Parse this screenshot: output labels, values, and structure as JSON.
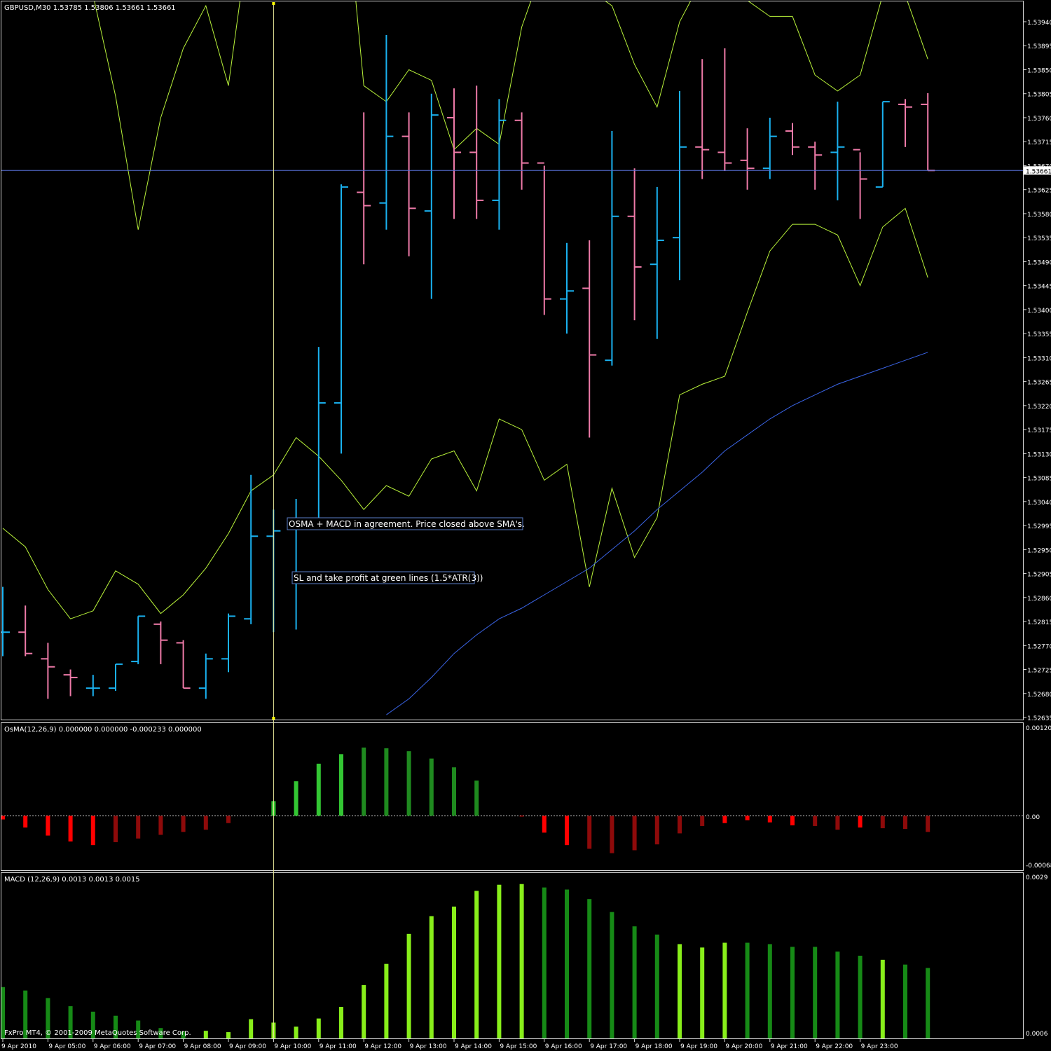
{
  "main_panel": {
    "title": "GBPUSD,M30  1.53785 1.53806 1.53661 1.53661",
    "current_price_label": "1.53661",
    "price_ticks": [
      "1.53940",
      "1.53895",
      "1.53850",
      "1.53805",
      "1.53760",
      "1.53715",
      "1.53670",
      "1.53625",
      "1.53580",
      "1.53535",
      "1.53490",
      "1.53445",
      "1.53400",
      "1.53355",
      "1.53310",
      "1.53265",
      "1.53220",
      "1.53175",
      "1.53130",
      "1.53085",
      "1.53040",
      "1.52995",
      "1.52950",
      "1.52905",
      "1.52860",
      "1.52815",
      "1.52770",
      "1.52725",
      "1.52680",
      "1.52635"
    ]
  },
  "osma_panel": {
    "title": "OsMA(12,26,9) 0.000000 0.000000 -0.000233 0.000000",
    "top_label": "0.001206",
    "zero_label": "0.00",
    "bottom_label": "-0.000685"
  },
  "macd_panel": {
    "title": "MACD (12,26,9) 0.0013 0.0013 0.0015",
    "top_label": "0.0029",
    "bottom_label": "0.0006"
  },
  "annotations": [
    "OSMA + MACD in agreement. Price closed above SMA's.",
    "SL and take profit at green lines (1.5*ATR(3))"
  ],
  "copyright": "FxPro MT4, © 2001-2009 MetaQuotes Software Corp.",
  "time_labels": [
    "9 Apr 2010",
    "9 Apr 05:00",
    "9 Apr 06:00",
    "9 Apr 07:00",
    "9 Apr 08:00",
    "9 Apr 09:00",
    "9 Apr 10:00",
    "9 Apr 11:00",
    "9 Apr 12:00",
    "9 Apr 13:00",
    "9 Apr 14:00",
    "9 Apr 15:00",
    "9 Apr 16:00",
    "9 Apr 17:00",
    "9 Apr 18:00",
    "9 Apr 19:00",
    "9 Apr 20:00",
    "9 Apr 21:00",
    "9 Apr 22:00",
    "9 Apr 23:00"
  ],
  "colors": {
    "background": "#000000",
    "bull_bar": "#1ab2f0",
    "bear_bar": "#ee7aa8",
    "band_line": "#b8f23a",
    "sma_line": "#3a64e6",
    "price_line": "#5870d8",
    "osma_up_strong": "#33c633",
    "osma_up_weak": "#1f8a1f",
    "osma_down_strong": "#ff0000",
    "osma_down_weak": "#8e0a0a",
    "macd_rising": "#88ee1a",
    "macd_falling": "#168a16",
    "frame": "#d8d8d8",
    "text": "#ffffff"
  },
  "chart_data": [
    {
      "type": "ohlc",
      "name": "GBPUSD,M30",
      "time_step_minutes": 30,
      "first_bar_time": "9 Apr 2010 04:00",
      "ylim": [
        1.52635,
        1.53985
      ],
      "ohlc": [
        [
          1.52795,
          1.5288,
          1.5275,
          1.52795
        ],
        [
          1.52795,
          1.52845,
          1.5275,
          1.52755
        ],
        [
          1.52745,
          1.52775,
          1.5267,
          1.5273
        ],
        [
          1.52715,
          1.52725,
          1.52675,
          1.5271
        ],
        [
          1.5269,
          1.52715,
          1.52675,
          1.5269
        ],
        [
          1.5269,
          1.52735,
          1.52685,
          1.52735
        ],
        [
          1.5274,
          1.52825,
          1.52735,
          1.52825
        ],
        [
          1.5281,
          1.52815,
          1.52735,
          1.5278
        ],
        [
          1.52775,
          1.5278,
          1.5269,
          1.5269
        ],
        [
          1.5269,
          1.52755,
          1.5267,
          1.52745
        ],
        [
          1.52745,
          1.5283,
          1.5272,
          1.52825
        ],
        [
          1.5282,
          1.5309,
          1.5281,
          1.52975
        ],
        [
          1.52975,
          1.53025,
          1.52795,
          1.52985
        ],
        [
          1.5299,
          1.53045,
          1.528,
          1.52995
        ],
        [
          1.52995,
          1.5333,
          1.5299,
          1.53225
        ],
        [
          1.53225,
          1.53635,
          1.5313,
          1.5363
        ],
        [
          1.5362,
          1.5377,
          1.53485,
          1.53595
        ],
        [
          1.536,
          1.53915,
          1.5355,
          1.53725
        ],
        [
          1.53725,
          1.5377,
          1.535,
          1.5359
        ],
        [
          1.53585,
          1.53805,
          1.5342,
          1.53765
        ],
        [
          1.5376,
          1.53815,
          1.5357,
          1.53695
        ],
        [
          1.53695,
          1.5382,
          1.5357,
          1.53605
        ],
        [
          1.53605,
          1.53795,
          1.5355,
          1.53755
        ],
        [
          1.53755,
          1.5377,
          1.53625,
          1.53675
        ],
        [
          1.53675,
          1.5367,
          1.5339,
          1.5342
        ],
        [
          1.5342,
          1.53525,
          1.53355,
          1.53435
        ],
        [
          1.5344,
          1.5353,
          1.5316,
          1.53315
        ],
        [
          1.53305,
          1.53735,
          1.53295,
          1.53575
        ],
        [
          1.53575,
          1.53665,
          1.5338,
          1.5348
        ],
        [
          1.53485,
          1.5363,
          1.53345,
          1.5353
        ],
        [
          1.53535,
          1.5381,
          1.53455,
          1.53705
        ],
        [
          1.53705,
          1.5387,
          1.53645,
          1.537
        ],
        [
          1.53695,
          1.5389,
          1.5366,
          1.53675
        ],
        [
          1.5368,
          1.5374,
          1.53625,
          1.53665
        ],
        [
          1.53665,
          1.5376,
          1.53645,
          1.53725
        ],
        [
          1.53735,
          1.5375,
          1.5369,
          1.53705
        ],
        [
          1.53705,
          1.53715,
          1.53625,
          1.5369
        ],
        [
          1.53695,
          1.5379,
          1.53605,
          1.53705
        ],
        [
          1.537,
          1.53695,
          1.5357,
          1.53645
        ],
        [
          1.5363,
          1.5379,
          1.5363,
          1.5379
        ],
        [
          1.53785,
          1.53795,
          1.53705,
          1.5378
        ],
        [
          1.53785,
          1.53806,
          1.53661,
          1.53661
        ]
      ],
      "upper_band": [
        1.5398,
        1.5403,
        1.5416,
        1.5423,
        1.5399,
        1.538,
        1.5355,
        1.5376,
        1.5389,
        1.5397,
        1.5382,
        1.5413,
        1.5424,
        1.543,
        1.5429,
        1.5427,
        1.5382,
        1.5379,
        1.5385,
        1.5383,
        1.537,
        1.5374,
        1.5371,
        1.5393,
        1.5405,
        1.541,
        1.54,
        1.5397,
        1.5386,
        1.5378,
        1.5394,
        1.5402,
        1.5406,
        1.5398,
        1.5395,
        1.5395,
        1.5384,
        1.5381,
        1.5384,
        1.5399,
        1.5399,
        1.5387
      ],
      "lower_band": [
        1.5299,
        1.52955,
        1.52875,
        1.5282,
        1.52835,
        1.5291,
        1.52885,
        1.5283,
        1.52865,
        1.52915,
        1.5298,
        1.5306,
        1.5309,
        1.5316,
        1.53125,
        1.5308,
        1.53025,
        1.5307,
        1.5305,
        1.5312,
        1.53135,
        1.5306,
        1.53195,
        1.53175,
        1.5308,
        1.5311,
        1.5288,
        1.53065,
        1.52935,
        1.5301,
        1.5324,
        1.5326,
        1.53275,
        1.53395,
        1.5351,
        1.5356,
        1.5356,
        1.5354,
        1.53445,
        1.53555,
        1.5359,
        1.5346
      ],
      "sma": [
        null,
        null,
        null,
        null,
        null,
        null,
        null,
        null,
        null,
        null,
        null,
        null,
        null,
        null,
        null,
        null,
        null,
        1.5264,
        1.5267,
        1.5271,
        1.52755,
        1.5279,
        1.5282,
        1.5284,
        1.52865,
        1.5289,
        1.52915,
        1.5295,
        1.52985,
        1.53025,
        1.5306,
        1.53095,
        1.53135,
        1.53165,
        1.53195,
        1.5322,
        1.5324,
        1.5326,
        1.53275,
        1.5329,
        1.53305,
        1.5332
      ],
      "marker_bar_index": 12
    },
    {
      "type": "bar",
      "name": "OsMA(12,26,9)",
      "ylim": [
        -0.000685,
        0.001206
      ],
      "values": [
        -5e-05,
        -0.00016,
        -0.00027,
        -0.00035,
        -0.0004,
        -0.00036,
        -0.00031,
        -0.00026,
        -0.00022,
        -0.00019,
        -0.0001,
        0.0,
        0.0002,
        0.00047,
        0.00071,
        0.00084,
        0.00093,
        0.00092,
        0.00088,
        0.00078,
        0.00066,
        0.00048,
        0.0003,
        0.0,
        -0.00023,
        -0.0004,
        -0.00045,
        -0.00051,
        -0.00047,
        -0.00039,
        -0.00024,
        -0.00014,
        -0.0001,
        -6e-05,
        -9e-05,
        -0.00013,
        -0.00014,
        -0.00019,
        -0.00016,
        -0.00017,
        -0.00018,
        -0.00022
      ],
      "shade": [
        "down-strong",
        "down-strong",
        "down-strong",
        "down-strong",
        "down-strong",
        "down-weak",
        "down-weak",
        "down-weak",
        "down-weak",
        "down-weak",
        "down-weak",
        "none",
        "up-strong",
        "up-strong",
        "up-strong",
        "up-strong",
        "up-weak",
        "up-weak",
        "up-weak",
        "up-weak",
        "up-weak",
        "up-weak",
        "none",
        "down-strong",
        "down-strong",
        "down-strong",
        "down-weak",
        "down-weak",
        "down-weak",
        "down-weak",
        "down-weak",
        "down-weak",
        "down-strong",
        "down-strong",
        "down-strong",
        "down-strong",
        "down-weak",
        "down-weak",
        "down-strong",
        "down-weak",
        "down-weak",
        "down-weak"
      ]
    },
    {
      "type": "bar",
      "name": "MACD (12,26,9)",
      "ylim": [
        0.0006,
        0.0029
      ],
      "values": [
        0.00129,
        0.00124,
        0.00113,
        0.00101,
        0.00093,
        0.00087,
        0.0008,
        0.00069,
        0.00064,
        0.00065,
        0.00063,
        0.00082,
        0.00077,
        0.00071,
        0.00083,
        0.001,
        0.00132,
        0.00163,
        0.00207,
        0.00233,
        0.00247,
        0.0027,
        0.00279,
        0.0028,
        0.00275,
        0.00272,
        0.00258,
        0.00239,
        0.00218,
        0.00206,
        0.00192,
        0.00187,
        0.00194,
        0.00194,
        0.00192,
        0.00188,
        0.00188,
        0.00181,
        0.00175,
        0.00169,
        0.00162,
        0.00157
      ],
      "shade": [
        "falling",
        "falling",
        "falling",
        "falling",
        "falling",
        "falling",
        "falling",
        "falling",
        "falling",
        "rising",
        "rising",
        "rising",
        "rising",
        "rising",
        "rising",
        "rising",
        "rising",
        "rising",
        "rising",
        "rising",
        "rising",
        "rising",
        "rising",
        "rising",
        "falling",
        "falling",
        "falling",
        "falling",
        "falling",
        "falling",
        "rising",
        "rising",
        "rising",
        "falling",
        "falling",
        "falling",
        "falling",
        "falling",
        "falling",
        "rising",
        "falling",
        "falling"
      ]
    }
  ]
}
